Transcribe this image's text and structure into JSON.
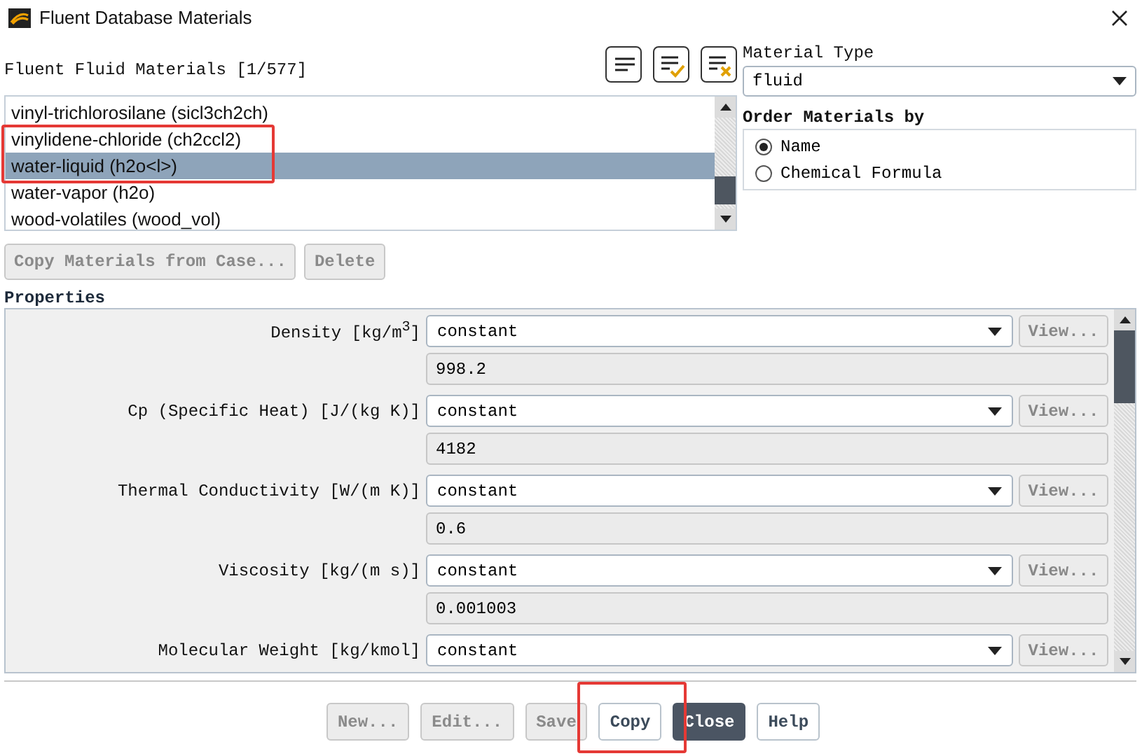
{
  "window": {
    "title": "Fluent Database Materials"
  },
  "materials": {
    "label": "Fluent Fluid Materials [1/577]",
    "items": [
      {
        "name": "vinyl-trichlorosilane (sicl3ch2ch)",
        "selected": false,
        "highlighted": false
      },
      {
        "name": "vinylidene-chloride (ch2ccl2)",
        "selected": false,
        "highlighted": true
      },
      {
        "name": "water-liquid (h2o<l>)",
        "selected": true,
        "highlighted": true
      },
      {
        "name": "water-vapor (h2o)",
        "selected": false,
        "highlighted": false
      },
      {
        "name": "wood-volatiles (wood_vol)",
        "selected": false,
        "highlighted": false
      }
    ],
    "buttons": [
      {
        "label": "Copy Materials from Case...",
        "disabled": true
      },
      {
        "label": "Delete",
        "disabled": true
      }
    ]
  },
  "material_type": {
    "label": "Material Type",
    "value": "fluid"
  },
  "order_by": {
    "label": "Order Materials by",
    "options": [
      {
        "label": "Name",
        "selected": true
      },
      {
        "label": "Chemical Formula",
        "selected": false
      }
    ]
  },
  "properties": {
    "label": "Properties",
    "rows": [
      {
        "label": "Density [kg/m$^{3}$]",
        "method": "constant",
        "view": "View...",
        "value": "998.2"
      },
      {
        "label": "Cp (Specific Heat) [J/(kg K)]",
        "method": "constant",
        "view": "View...",
        "value": "4182"
      },
      {
        "label": "Thermal Conductivity [W/(m K)]",
        "method": "constant",
        "view": "View...",
        "value": "0.6"
      },
      {
        "label": "Viscosity [kg/(m s)]",
        "method": "constant",
        "view": "View...",
        "value": "0.001003"
      },
      {
        "label": "Molecular Weight [kg/kmol]",
        "method": "constant",
        "view": "View..."
      }
    ]
  },
  "footer": [
    {
      "label": "New...",
      "kind": "normal",
      "disabled": true,
      "highlighted": false
    },
    {
      "label": "Edit...",
      "kind": "normal",
      "disabled": true,
      "highlighted": false
    },
    {
      "label": "Save",
      "kind": "normal",
      "disabled": true,
      "highlighted": false
    },
    {
      "label": "Copy",
      "kind": "normal",
      "disabled": false,
      "highlighted": true
    },
    {
      "label": "Close",
      "kind": "primary",
      "disabled": false,
      "highlighted": false
    },
    {
      "label": "Help",
      "kind": "normal",
      "disabled": false,
      "highlighted": false
    }
  ]
}
